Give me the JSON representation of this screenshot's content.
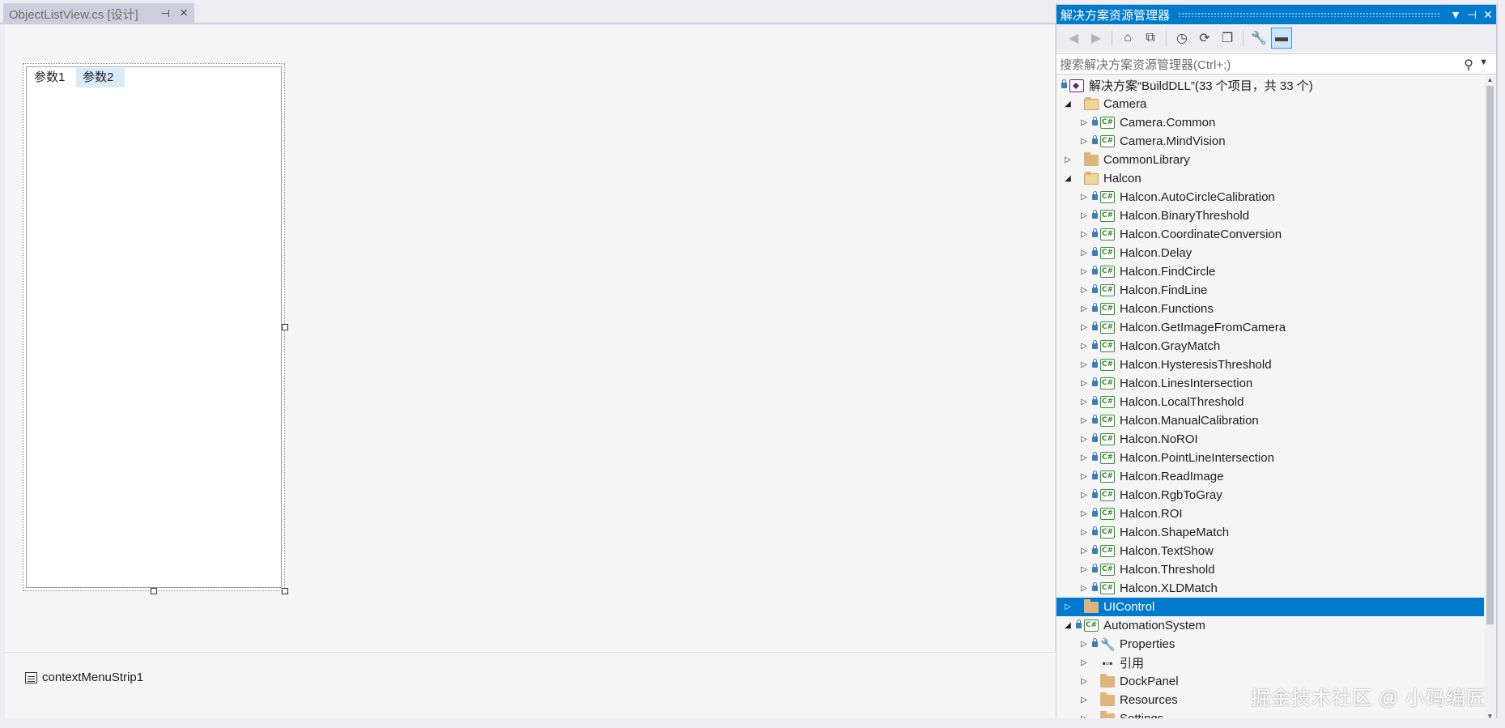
{
  "document_tab": {
    "title": "ObjectListView.cs [设计]",
    "pin_icon": "pin-icon",
    "close_icon": "close-icon"
  },
  "designer": {
    "column_headers": [
      "参数1",
      "参数2"
    ],
    "tray_component": "contextMenuStrip1"
  },
  "solution_explorer": {
    "title": "解决方案资源管理器",
    "title_buttons": [
      "▼",
      "⊣",
      "✕"
    ],
    "search_placeholder": "搜索解决方案资源管理器(Ctrl+;)",
    "solution_label": "解决方案“BuildDLL”(33 个项目，共 33 个)",
    "toolbar": [
      {
        "icon": "back-icon",
        "glyph": "◀",
        "enabled": false
      },
      {
        "icon": "forward-icon",
        "glyph": "▶",
        "enabled": false
      },
      {
        "icon": "home-icon",
        "glyph": "⌂",
        "enabled": true
      },
      {
        "icon": "switch-views-icon",
        "glyph": "⧉",
        "enabled": true
      },
      {
        "icon": "pending-changes-icon",
        "glyph": "◷",
        "enabled": true
      },
      {
        "icon": "refresh-icon",
        "glyph": "⟳",
        "enabled": true
      },
      {
        "icon": "collapse-all-icon",
        "glyph": "❐",
        "enabled": true
      },
      {
        "icon": "properties-icon",
        "glyph": "🔧",
        "enabled": true
      },
      {
        "icon": "preview-icon",
        "glyph": "▬",
        "enabled": true,
        "active": true
      }
    ],
    "tree": [
      {
        "level": 1,
        "expander": "open",
        "type": "folder-open",
        "lock": false,
        "label": "Camera"
      },
      {
        "level": 2,
        "expander": "closed",
        "type": "cs",
        "lock": true,
        "label": "Camera.Common"
      },
      {
        "level": 2,
        "expander": "closed",
        "type": "cs",
        "lock": true,
        "label": "Camera.MindVision"
      },
      {
        "level": 1,
        "expander": "closed",
        "type": "folder",
        "lock": false,
        "label": "CommonLibrary"
      },
      {
        "level": 1,
        "expander": "open",
        "type": "folder-open",
        "lock": false,
        "label": "Halcon"
      },
      {
        "level": 2,
        "expander": "closed",
        "type": "cs",
        "lock": true,
        "label": "Halcon.AutoCircleCalibration"
      },
      {
        "level": 2,
        "expander": "closed",
        "type": "cs",
        "lock": true,
        "label": "Halcon.BinaryThreshold"
      },
      {
        "level": 2,
        "expander": "closed",
        "type": "cs",
        "lock": true,
        "label": "Halcon.CoordinateConversion"
      },
      {
        "level": 2,
        "expander": "closed",
        "type": "cs",
        "lock": true,
        "label": "Halcon.Delay"
      },
      {
        "level": 2,
        "expander": "closed",
        "type": "cs",
        "lock": true,
        "label": "Halcon.FindCircle"
      },
      {
        "level": 2,
        "expander": "closed",
        "type": "cs",
        "lock": true,
        "label": "Halcon.FindLine"
      },
      {
        "level": 2,
        "expander": "closed",
        "type": "cs",
        "lock": true,
        "label": "Halcon.Functions"
      },
      {
        "level": 2,
        "expander": "closed",
        "type": "cs",
        "lock": true,
        "label": "Halcon.GetImageFromCamera"
      },
      {
        "level": 2,
        "expander": "closed",
        "type": "cs",
        "lock": true,
        "label": "Halcon.GrayMatch"
      },
      {
        "level": 2,
        "expander": "closed",
        "type": "cs",
        "lock": true,
        "label": "Halcon.HysteresisThreshold"
      },
      {
        "level": 2,
        "expander": "closed",
        "type": "cs",
        "lock": true,
        "label": "Halcon.LinesIntersection"
      },
      {
        "level": 2,
        "expander": "closed",
        "type": "cs",
        "lock": true,
        "label": "Halcon.LocalThreshold"
      },
      {
        "level": 2,
        "expander": "closed",
        "type": "cs",
        "lock": true,
        "label": "Halcon.ManualCalibration"
      },
      {
        "level": 2,
        "expander": "closed",
        "type": "cs",
        "lock": true,
        "label": "Halcon.NoROI"
      },
      {
        "level": 2,
        "expander": "closed",
        "type": "cs",
        "lock": true,
        "label": "Halcon.PointLineIntersection"
      },
      {
        "level": 2,
        "expander": "closed",
        "type": "cs",
        "lock": true,
        "label": "Halcon.ReadImage"
      },
      {
        "level": 2,
        "expander": "closed",
        "type": "cs",
        "lock": true,
        "label": "Halcon.RgbToGray"
      },
      {
        "level": 2,
        "expander": "closed",
        "type": "cs",
        "lock": true,
        "label": "Halcon.ROI"
      },
      {
        "level": 2,
        "expander": "closed",
        "type": "cs",
        "lock": true,
        "label": "Halcon.ShapeMatch"
      },
      {
        "level": 2,
        "expander": "closed",
        "type": "cs",
        "lock": true,
        "label": "Halcon.TextShow"
      },
      {
        "level": 2,
        "expander": "closed",
        "type": "cs",
        "lock": true,
        "label": "Halcon.Threshold"
      },
      {
        "level": 2,
        "expander": "closed",
        "type": "cs",
        "lock": true,
        "label": "Halcon.XLDMatch"
      },
      {
        "level": 1,
        "expander": "closed",
        "type": "folder",
        "lock": false,
        "label": "UIControl",
        "selected": true
      },
      {
        "level": 1,
        "expander": "open",
        "type": "cs",
        "lock": true,
        "label": "AutomationSystem"
      },
      {
        "level": 2,
        "expander": "closed",
        "type": "wrench",
        "lock": true,
        "label": "Properties"
      },
      {
        "level": 2,
        "expander": "closed",
        "type": "refs",
        "lock": false,
        "label": "引用"
      },
      {
        "level": 2,
        "expander": "closed",
        "type": "folder",
        "lock": false,
        "label": "DockPanel"
      },
      {
        "level": 2,
        "expander": "closed",
        "type": "folder",
        "lock": false,
        "label": "Resources"
      },
      {
        "level": 2,
        "expander": "closed",
        "type": "folder",
        "lock": false,
        "label": "Settings"
      }
    ]
  },
  "watermark": "掘金技术社区 @ 小码编匠",
  "colors": {
    "accent": "#007acc",
    "selection": "#007acc",
    "csharp_icon": "#388a34",
    "folder": "#dcb67a",
    "solution_icon": "#68217a"
  }
}
